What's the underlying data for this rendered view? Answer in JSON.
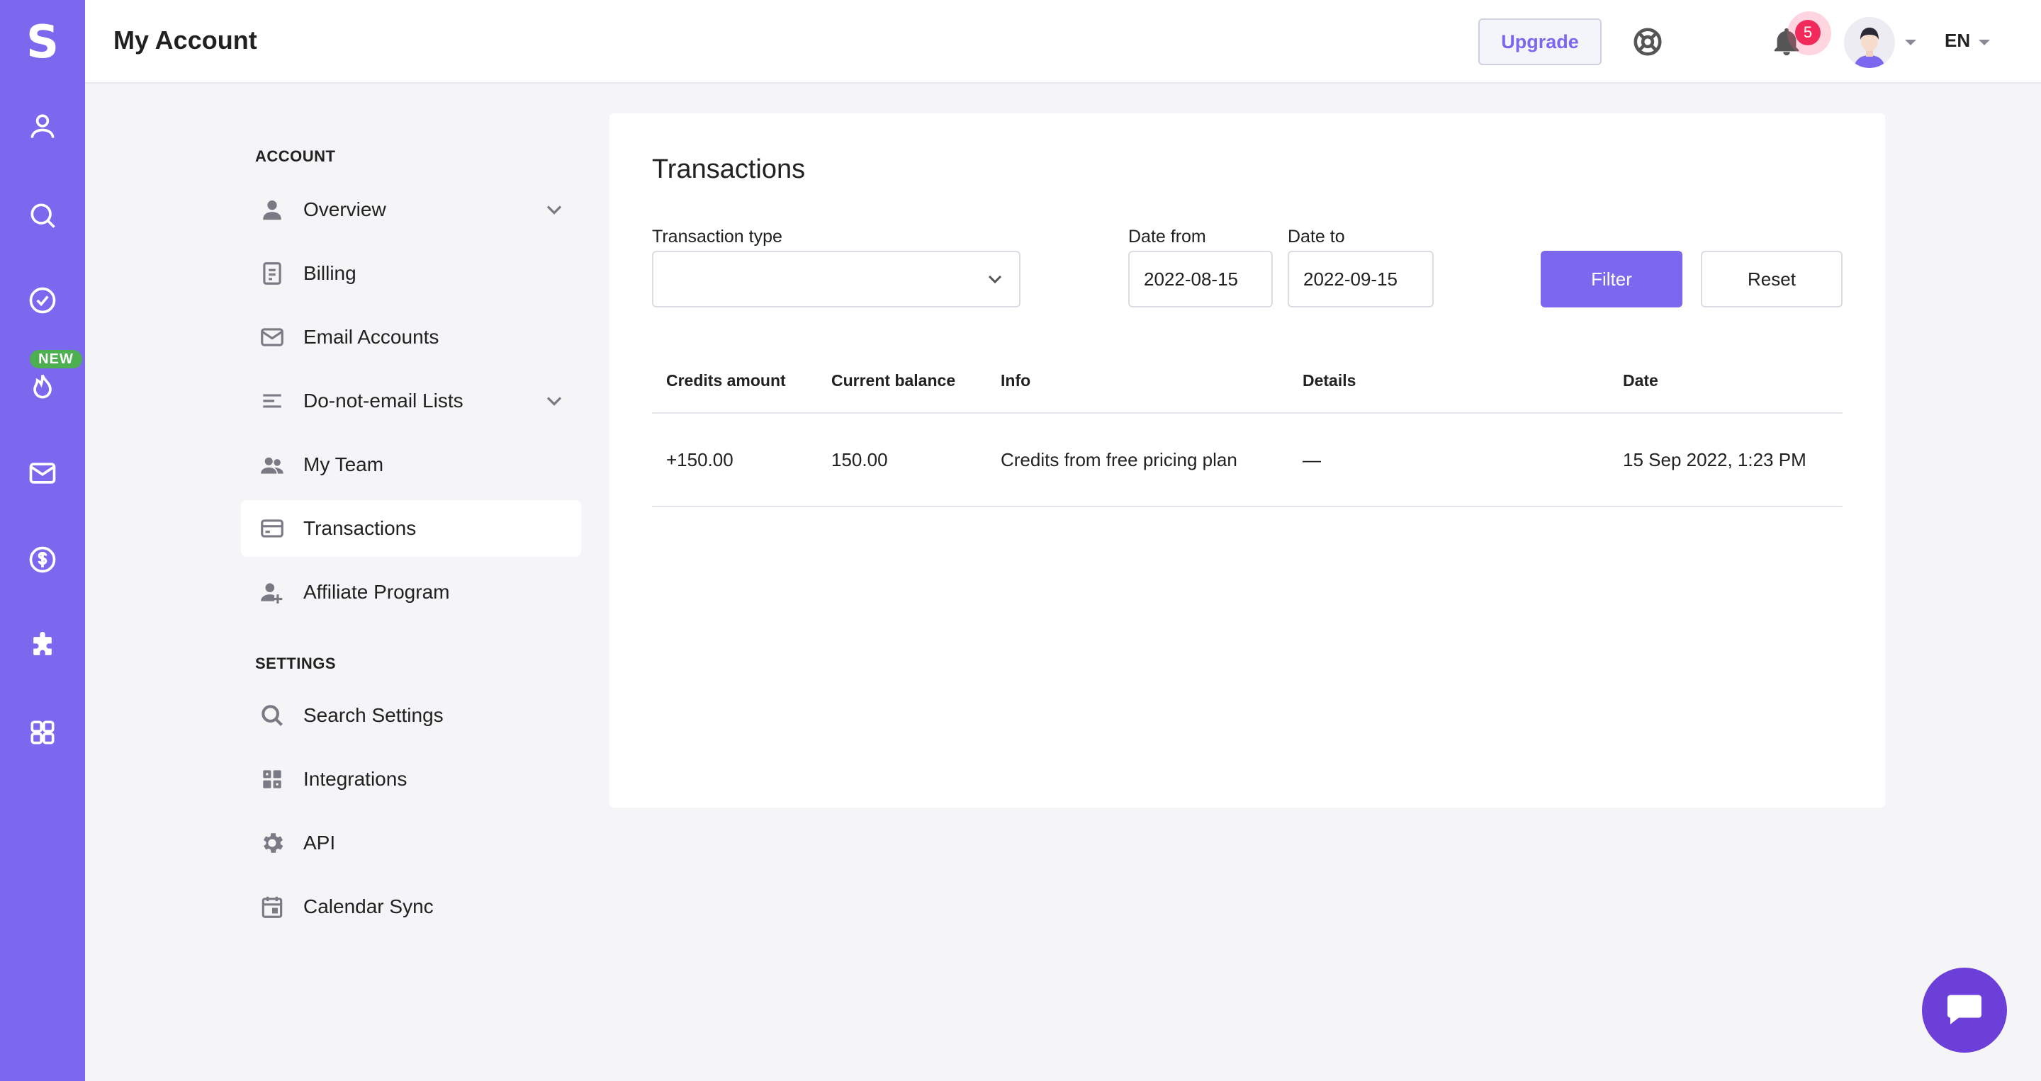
{
  "app": {
    "logo_letter": "S",
    "rail_badge": "NEW"
  },
  "header": {
    "title": "My Account",
    "upgrade_label": "Upgrade",
    "notification_count": "5",
    "language": "EN"
  },
  "nav": {
    "account_heading": "ACCOUNT",
    "settings_heading": "SETTINGS",
    "account_items": [
      {
        "label": "Overview",
        "icon": "person-icon",
        "expandable": true
      },
      {
        "label": "Billing",
        "icon": "document-icon",
        "expandable": false
      },
      {
        "label": "Email Accounts",
        "icon": "mail-icon",
        "expandable": false
      },
      {
        "label": "Do-not-email Lists",
        "icon": "list-icon",
        "expandable": true
      },
      {
        "label": "My Team",
        "icon": "team-icon",
        "expandable": false
      },
      {
        "label": "Transactions",
        "icon": "credit-card-icon",
        "active": true
      },
      {
        "label": "Affiliate Program",
        "icon": "person-add-icon",
        "expandable": false
      }
    ],
    "settings_items": [
      {
        "label": "Search Settings",
        "icon": "search-icon"
      },
      {
        "label": "Integrations",
        "icon": "grid-icon"
      },
      {
        "label": "API",
        "icon": "gear-icon"
      },
      {
        "label": "Calendar Sync",
        "icon": "calendar-icon"
      }
    ]
  },
  "transactions": {
    "title": "Transactions",
    "filters": {
      "type_label": "Transaction type",
      "type_value": "",
      "date_from_label": "Date from",
      "date_from_value": "2022-08-15",
      "date_to_label": "Date to",
      "date_to_value": "2022-09-15",
      "filter_button": "Filter",
      "reset_button": "Reset"
    },
    "columns": [
      "Credits amount",
      "Current balance",
      "Info",
      "Details",
      "Date"
    ],
    "rows": [
      [
        "+150.00",
        "150.00",
        "Credits from free pricing plan",
        "—",
        "15 Sep 2022, 1:23 PM"
      ]
    ]
  },
  "colors": {
    "brand": "#7b68ee",
    "chat": "#6c3fd8",
    "badge_green": "#4caf50",
    "notification": "#f2295b"
  }
}
